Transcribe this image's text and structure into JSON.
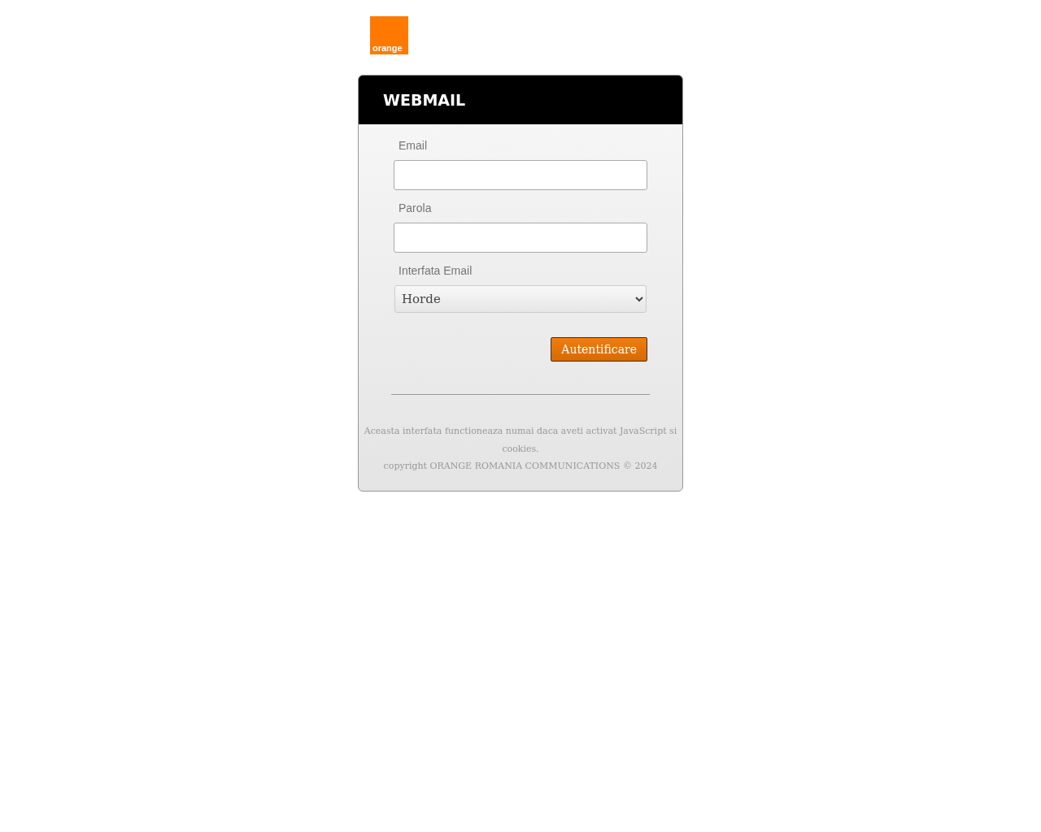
{
  "logo": {
    "text": "orange"
  },
  "header": {
    "title": "WEBMAIL"
  },
  "fields": [
    {
      "kind": "text",
      "label": "Email"
    },
    {
      "kind": "password",
      "label": "Parola"
    },
    {
      "kind": "select",
      "label": "Interfata Email",
      "value": "Horde"
    }
  ],
  "submit": {
    "label": "Autentificare"
  },
  "footer": {
    "notice": "Aceasta interfata functioneaza numai daca aveti activat JavaScript si cookies.",
    "copyright": "copyright ORANGE ROMANIA COMMUNICATIONS © 2024"
  }
}
